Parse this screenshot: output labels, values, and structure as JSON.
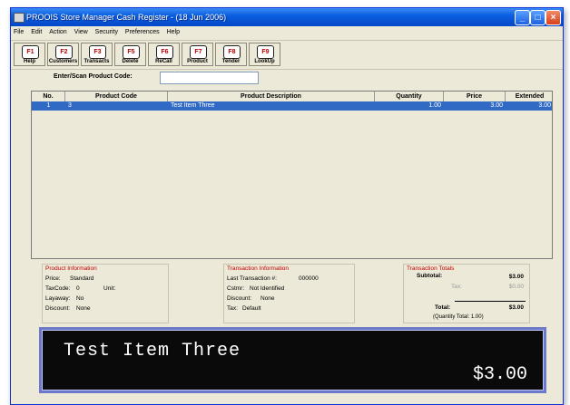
{
  "window": {
    "title": "PROOIS Store Manager Cash Register - (18 Jun 2006)",
    "minimize_glyph": "_",
    "maximize_glyph": "□",
    "close_glyph": "×"
  },
  "menu": {
    "items": [
      "File",
      "Edit",
      "Action",
      "View",
      "Security",
      "Preferences",
      "Help"
    ]
  },
  "toolbar": {
    "buttons": [
      {
        "key": "F1",
        "label": "Help"
      },
      {
        "key": "F2",
        "label": "Customers"
      },
      {
        "key": "F3",
        "label": "Transacts"
      },
      {
        "key": "F5",
        "label": "Delete"
      },
      {
        "key": "F6",
        "label": "ReCall"
      },
      {
        "key": "F7",
        "label": "Product"
      },
      {
        "key": "F8",
        "label": "Tender"
      },
      {
        "key": "F9",
        "label": "LookUp"
      }
    ]
  },
  "entry": {
    "label": "Enter/Scan Product Code:",
    "value": ""
  },
  "grid": {
    "columns": [
      "No.",
      "Product Code",
      "Product Description",
      "Quantity",
      "Price",
      "Extended"
    ],
    "rows": [
      {
        "no": "1",
        "code": "3",
        "description": "Test Item Three",
        "quantity": "1.00",
        "price": "3.00",
        "extended": "3.00"
      }
    ]
  },
  "product_info": {
    "title": "Product Information",
    "price_label": "Price:",
    "price_value": "Standard",
    "taxcode_label": "TaxCode:",
    "taxcode_value": "0",
    "unit_label": "Unit:",
    "layaway_label": "Layaway:",
    "layaway_value": "No",
    "discount_label": "Discount:",
    "discount_value": "None"
  },
  "transaction_info": {
    "title": "Transaction Information",
    "last_label": "Last Transaction #:",
    "last_value": "000000",
    "cust_label": "Cstmr:",
    "cust_value": "Not Identified",
    "discount_label": "Discount:",
    "discount_value": "None",
    "tax_label": "Tax:",
    "tax_value": "Default"
  },
  "totals": {
    "title": "Transaction Totals",
    "subtotal_label": "Subtotal:",
    "subtotal_value": "$3.00",
    "tax_label": "Tax:",
    "tax_value": "$0.00",
    "total_label": "Total:",
    "total_value": "$3.00",
    "qty_note": "(Quantity Total: 1.00)"
  },
  "display": {
    "description": "Test Item Three",
    "price": "$3.00"
  }
}
